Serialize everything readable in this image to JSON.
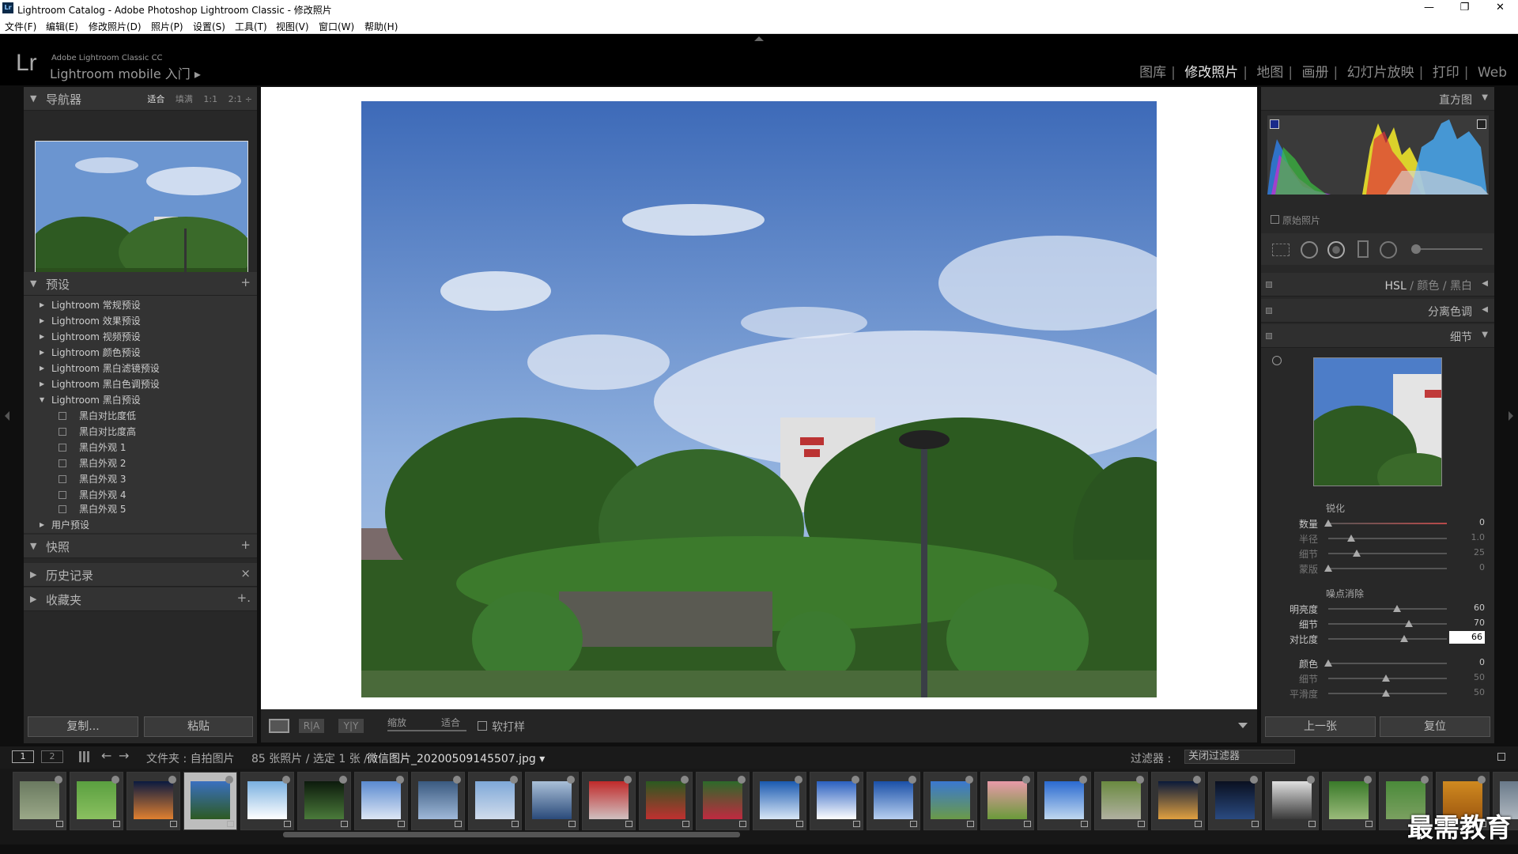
{
  "window": {
    "title": "Lightroom Catalog - Adobe Photoshop Lightroom Classic - 修改照片",
    "lr_badge": "Lr",
    "min": "—",
    "max": "❐",
    "close": "✕"
  },
  "menu": [
    "文件(F)",
    "编辑(E)",
    "修改照片(D)",
    "照片(P)",
    "设置(S)",
    "工具(T)",
    "视图(V)",
    "窗口(W)",
    "帮助(H)"
  ],
  "identity": {
    "logo": "Lr",
    "product": "Adobe Lightroom Classic CC",
    "mobile": "Lightroom mobile 入门 ▸"
  },
  "modules": {
    "items": [
      "图库",
      "修改照片",
      "地图",
      "画册",
      "幻灯片放映",
      "打印",
      "Web"
    ],
    "active": "修改照片",
    "sep": "|"
  },
  "left": {
    "navigator": {
      "title": "导航器",
      "options": [
        "适合",
        "填满",
        "1:1",
        "2:1 ÷"
      ],
      "active": "适合",
      "tri": "▼"
    },
    "presets": {
      "title": "预设",
      "tri": "▼",
      "add": "+",
      "items": [
        {
          "label": "Lightroom 常规预设",
          "open": false
        },
        {
          "label": "Lightroom 效果预设",
          "open": false
        },
        {
          "label": "Lightroom 视频预设",
          "open": false
        },
        {
          "label": "Lightroom 颜色预设",
          "open": false
        },
        {
          "label": "Lightroom 黑白滤镜预设",
          "open": false
        },
        {
          "label": "Lightroom 黑白色调预设",
          "open": false
        },
        {
          "label": "Lightroom 黑白预设",
          "open": true
        }
      ],
      "sub": [
        "黑白对比度低",
        "黑白对比度高",
        "黑白外观 1",
        "黑白外观 2",
        "黑白外观 3",
        "黑白外观 4",
        "黑白外观 5"
      ],
      "user": "用户预设"
    },
    "snapshots": {
      "title": "快照",
      "tri": "▼",
      "act": "+"
    },
    "history": {
      "title": "历史记录",
      "tri": "▶",
      "act": "×"
    },
    "collections": {
      "title": "收藏夹",
      "tri": "▶",
      "act": "+."
    },
    "copy": "复制...",
    "paste": "粘贴"
  },
  "toolbar": {
    "zoom": "缩放",
    "fit": "适合",
    "softproof": "软打样",
    "ra": "R|A",
    "yy": "Y|Y"
  },
  "right": {
    "histogram": {
      "title": "直方图",
      "tri": "▼",
      "original": "原始照片"
    },
    "hsl": {
      "title": "HSL",
      "sep": "/",
      "color": "颜色",
      "bw": "黑白",
      "tri": "◀"
    },
    "split": {
      "title": "分离色调",
      "tri": "◀"
    },
    "detail": {
      "title": "细节",
      "tri": "▼"
    },
    "sharpen": {
      "title": "锐化",
      "sliders": [
        {
          "label": "数量",
          "value": "0",
          "pos": 0.0,
          "dim": false
        },
        {
          "label": "半径",
          "value": "1.0",
          "pos": 0.2,
          "dim": true
        },
        {
          "label": "细节",
          "value": "25",
          "pos": 0.25,
          "dim": true
        },
        {
          "label": "蒙版",
          "value": "0",
          "pos": 0.0,
          "dim": true
        }
      ]
    },
    "noise": {
      "title": "噪点消除",
      "sliders": [
        {
          "label": "明亮度",
          "value": "60",
          "pos": 0.6,
          "dim": false
        },
        {
          "label": "细节",
          "value": "70",
          "pos": 0.7,
          "dim": false
        },
        {
          "label": "对比度",
          "value": "66",
          "pos": 0.66,
          "dim": false,
          "box": true
        },
        {
          "label": "颜色",
          "value": "0",
          "pos": 0.0,
          "dim": false
        },
        {
          "label": "细节",
          "value": "50",
          "pos": 0.5,
          "dim": true
        },
        {
          "label": "平滑度",
          "value": "50",
          "pos": 0.5,
          "dim": true
        }
      ]
    },
    "prev": "上一张",
    "reset": "复位"
  },
  "filmbar": {
    "page1": "1",
    "page2": "2",
    "folder": "文件夹 : 自拍图片",
    "count": "85 张照片 / 选定 1 张 /",
    "file": "微信图片_20200509145507.jpg ▾",
    "filter_label": "过滤器 :",
    "filter_value": "关闭过滤器"
  },
  "watermark": "最需教育",
  "colors": {
    "accent": "#e8e8e8",
    "bg": "#282828",
    "selected_thumb": "#bdbdbd"
  }
}
